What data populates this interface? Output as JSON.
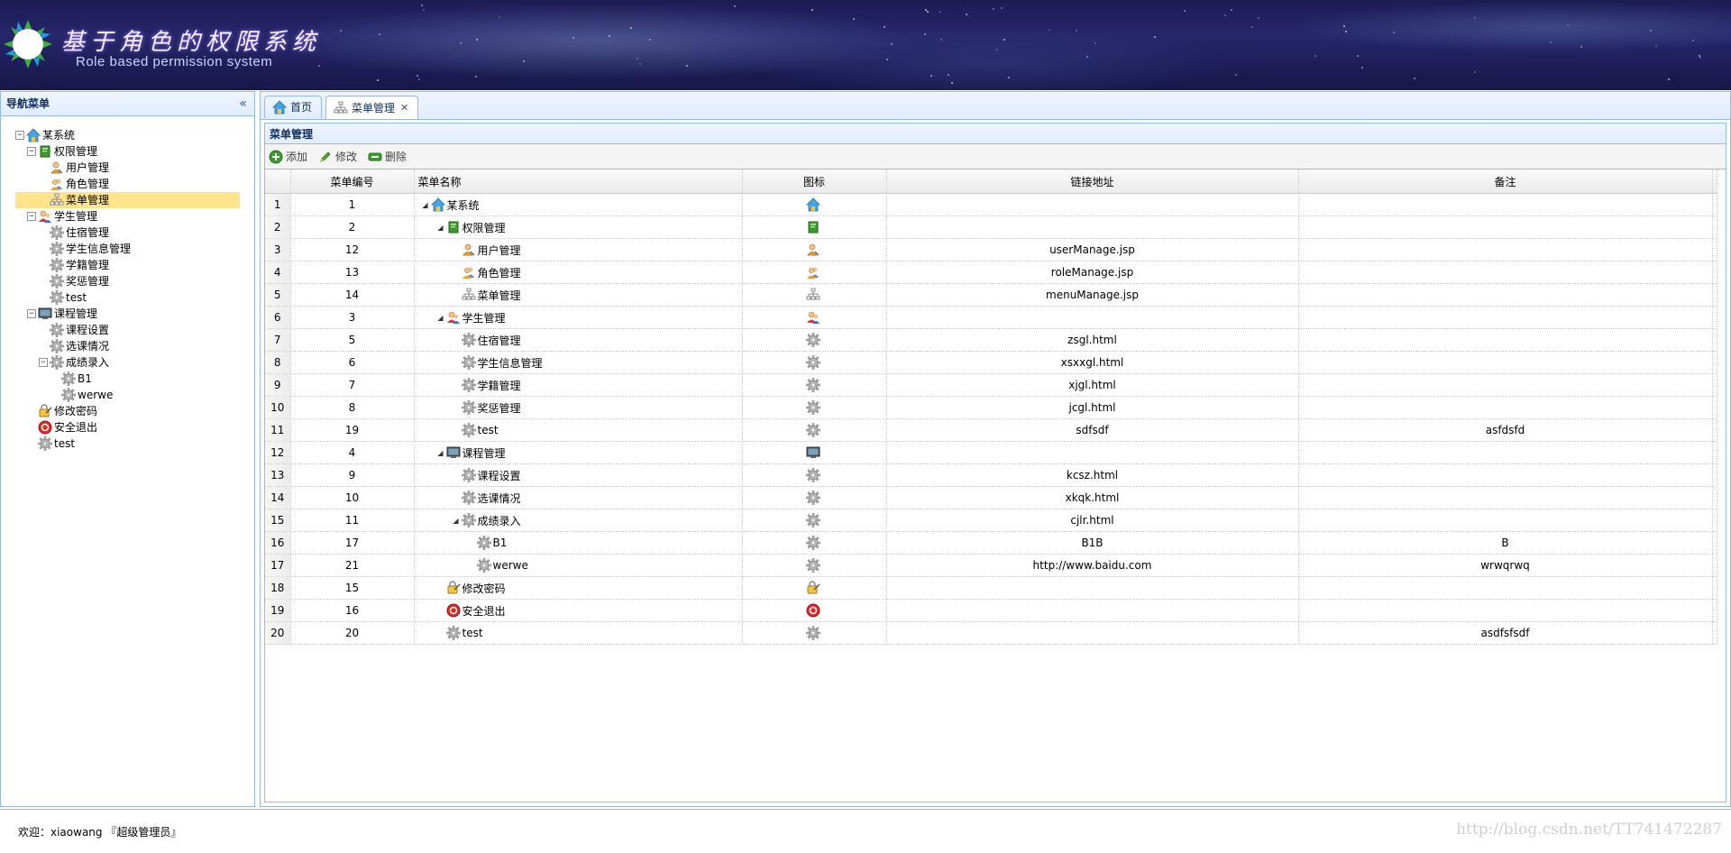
{
  "header": {
    "title": "基于角色的权限系统",
    "subtitle": "Role based permission system"
  },
  "nav": {
    "title": "导航菜单",
    "collapse_glyph": "«",
    "tree": [
      {
        "label": "某系统",
        "icon": "house-icon",
        "depth": 0,
        "toggle": "⊟"
      },
      {
        "label": "权限管理",
        "icon": "green-book-icon",
        "depth": 1,
        "toggle": "⊟"
      },
      {
        "label": "用户管理",
        "icon": "user-icon",
        "depth": 2
      },
      {
        "label": "角色管理",
        "icon": "users-icon",
        "depth": 2
      },
      {
        "label": "菜单管理",
        "icon": "sitemap-icon",
        "depth": 2,
        "selected": true
      },
      {
        "label": "学生管理",
        "icon": "students-icon",
        "depth": 1,
        "toggle": "⊟"
      },
      {
        "label": "住宿管理",
        "icon": "gear-icon",
        "depth": 2
      },
      {
        "label": "学生信息管理",
        "icon": "gear-icon",
        "depth": 2
      },
      {
        "label": "学籍管理",
        "icon": "gear-icon",
        "depth": 2
      },
      {
        "label": "奖惩管理",
        "icon": "gear-icon",
        "depth": 2
      },
      {
        "label": "test",
        "icon": "gear-icon",
        "depth": 2
      },
      {
        "label": "课程管理",
        "icon": "monitor-icon",
        "depth": 1,
        "toggle": "⊟"
      },
      {
        "label": "课程设置",
        "icon": "gear-icon",
        "depth": 2
      },
      {
        "label": "选课情况",
        "icon": "gear-icon",
        "depth": 2
      },
      {
        "label": "成绩录入",
        "icon": "gear-icon",
        "depth": 2,
        "toggle": "⊟"
      },
      {
        "label": "B1",
        "icon": "gear-icon",
        "depth": 3
      },
      {
        "label": "werwe",
        "icon": "gear-icon",
        "depth": 3
      },
      {
        "label": "修改密码",
        "icon": "key-icon",
        "depth": 1
      },
      {
        "label": "安全退出",
        "icon": "exit-icon",
        "depth": 1
      },
      {
        "label": "test",
        "icon": "gear-icon",
        "depth": 1
      }
    ]
  },
  "tabs": [
    {
      "label": "首页",
      "icon": "house-icon",
      "active": false,
      "closable": false
    },
    {
      "label": "菜单管理",
      "icon": "sitemap-icon",
      "active": true,
      "closable": true
    }
  ],
  "panel": {
    "title": "菜单管理"
  },
  "toolbar": {
    "add_label": "添加",
    "edit_label": "修改",
    "delete_label": "删除"
  },
  "grid": {
    "columns": [
      "菜单编号",
      "菜单名称",
      "图标",
      "链接地址",
      "备注"
    ],
    "rows": [
      {
        "rn": "1",
        "id": "1",
        "name": "某系统",
        "icon": "house-icon",
        "level": 0,
        "expand": true,
        "url": "",
        "note": ""
      },
      {
        "rn": "2",
        "id": "2",
        "name": "权限管理",
        "icon": "green-book-icon",
        "level": 1,
        "expand": true,
        "url": "",
        "note": ""
      },
      {
        "rn": "3",
        "id": "12",
        "name": "用户管理",
        "icon": "user-icon",
        "level": 2,
        "url": "userManage.jsp",
        "note": ""
      },
      {
        "rn": "4",
        "id": "13",
        "name": "角色管理",
        "icon": "users-icon",
        "level": 2,
        "url": "roleManage.jsp",
        "note": ""
      },
      {
        "rn": "5",
        "id": "14",
        "name": "菜单管理",
        "icon": "sitemap-icon",
        "level": 2,
        "url": "menuManage.jsp",
        "note": ""
      },
      {
        "rn": "6",
        "id": "3",
        "name": "学生管理",
        "icon": "students-icon",
        "level": 1,
        "expand": true,
        "url": "",
        "note": ""
      },
      {
        "rn": "7",
        "id": "5",
        "name": "住宿管理",
        "icon": "gear-icon",
        "level": 2,
        "url": "zsgl.html",
        "note": ""
      },
      {
        "rn": "8",
        "id": "6",
        "name": "学生信息管理",
        "icon": "gear-icon",
        "level": 2,
        "url": "xsxxgl.html",
        "note": ""
      },
      {
        "rn": "9",
        "id": "7",
        "name": "学籍管理",
        "icon": "gear-icon",
        "level": 2,
        "url": "xjgl.html",
        "note": ""
      },
      {
        "rn": "10",
        "id": "8",
        "name": "奖惩管理",
        "icon": "gear-icon",
        "level": 2,
        "url": "jcgl.html",
        "note": ""
      },
      {
        "rn": "11",
        "id": "19",
        "name": "test",
        "icon": "gear-icon",
        "level": 2,
        "url": "sdfsdf",
        "note": "asfdsfd"
      },
      {
        "rn": "12",
        "id": "4",
        "name": "课程管理",
        "icon": "monitor-icon",
        "level": 1,
        "expand": true,
        "url": "",
        "note": ""
      },
      {
        "rn": "13",
        "id": "9",
        "name": "课程设置",
        "icon": "gear-icon",
        "level": 2,
        "url": "kcsz.html",
        "note": ""
      },
      {
        "rn": "14",
        "id": "10",
        "name": "选课情况",
        "icon": "gear-icon",
        "level": 2,
        "url": "xkqk.html",
        "note": ""
      },
      {
        "rn": "15",
        "id": "11",
        "name": "成绩录入",
        "icon": "gear-icon",
        "level": 2,
        "expand": true,
        "url": "cjlr.html",
        "note": ""
      },
      {
        "rn": "16",
        "id": "17",
        "name": "B1",
        "icon": "gear-icon",
        "level": 3,
        "url": "B1B",
        "note": "B"
      },
      {
        "rn": "17",
        "id": "21",
        "name": "werwe",
        "icon": "gear-icon",
        "level": 3,
        "url": "http://www.baidu.com",
        "note": "wrwqrwq"
      },
      {
        "rn": "18",
        "id": "15",
        "name": "修改密码",
        "icon": "key-icon",
        "level": 1,
        "url": "",
        "note": ""
      },
      {
        "rn": "19",
        "id": "16",
        "name": "安全退出",
        "icon": "exit-icon",
        "level": 1,
        "url": "",
        "note": ""
      },
      {
        "rn": "20",
        "id": "20",
        "name": "test",
        "icon": "gear-icon",
        "level": 1,
        "url": "",
        "note": "asdfsfsdf"
      }
    ]
  },
  "footer": {
    "welcome": "欢迎：xiaowang 『超级管理员』",
    "watermark": "http://blog.csdn.net/TT741472287"
  },
  "colors": {
    "border": "#95b8e7",
    "header_bg": "#1d1c55",
    "selected_bg": "#ffe48d",
    "panel_head": "#e0ecff"
  }
}
